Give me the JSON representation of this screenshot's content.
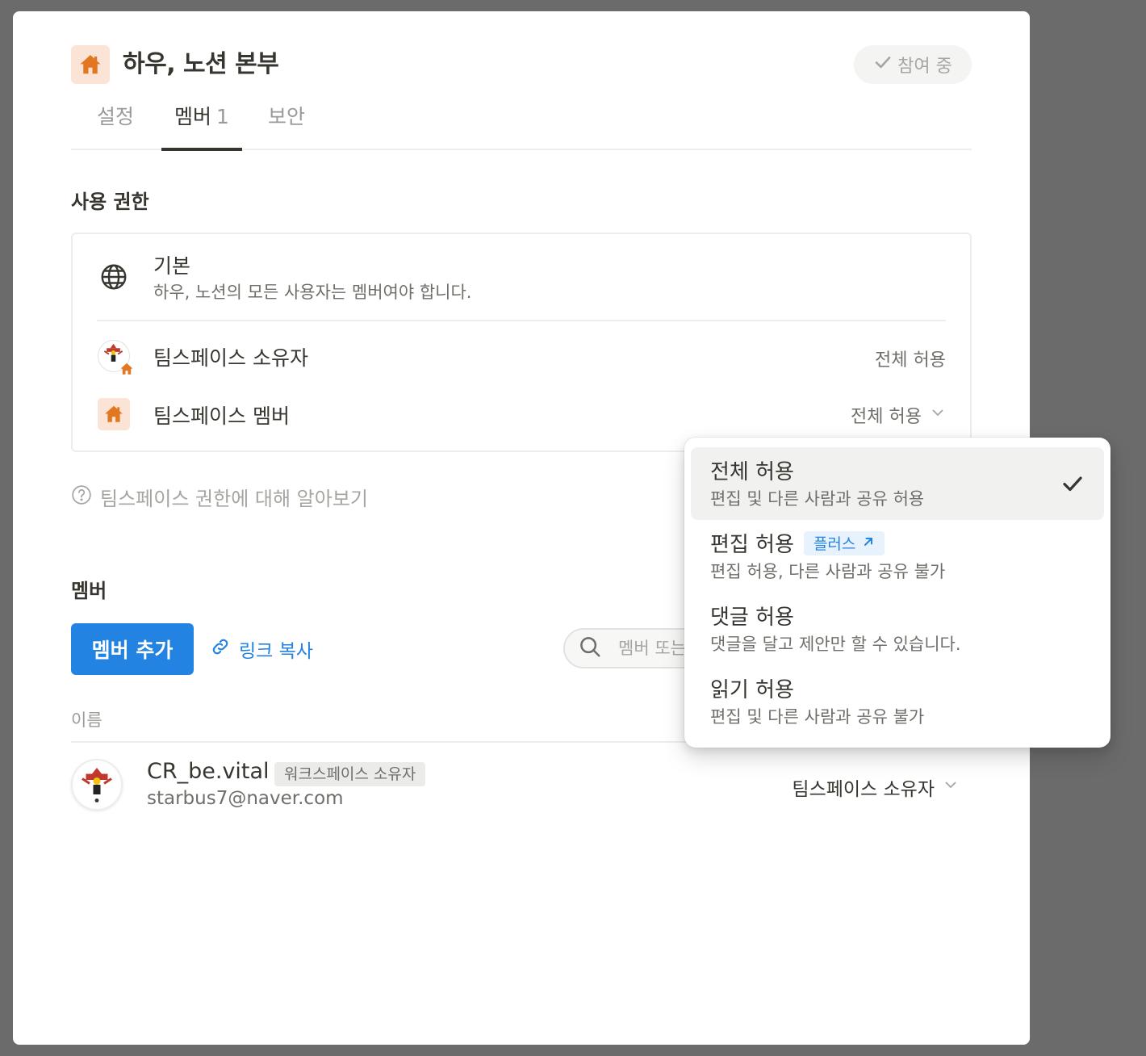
{
  "header": {
    "title": "하우, 노션 본부",
    "icon": "house-icon",
    "joined_label": "참여 중"
  },
  "tabs": [
    {
      "label": "설정"
    },
    {
      "label": "멤버",
      "count": "1"
    },
    {
      "label": "보안"
    }
  ],
  "permissions": {
    "heading": "사용 권한",
    "default": {
      "title": "기본",
      "description": "하우, 노션의 모든 사용자는 멤버여야 합니다."
    },
    "owner": {
      "title": "팀스페이스 소유자",
      "value": "전체 허용"
    },
    "member": {
      "title": "팀스페이스 멤버",
      "value": "전체 허용"
    },
    "learn_more": "팀스페이스 권한에 대해 알아보기"
  },
  "members": {
    "heading": "멤버",
    "add_button": "멤버 추가",
    "copy_link": "링크 복사",
    "search_placeholder": "멤버 또는 그룹 검색",
    "column_name": "이름",
    "list": [
      {
        "name": "CR_be.vital",
        "badge": "워크스페이스 소유자",
        "email": "starbus7@naver.com",
        "role": "팀스페이스 소유자"
      }
    ]
  },
  "dropdown": {
    "items": [
      {
        "title": "전체 허용",
        "description": "편집 및 다른 사람과 공유 허용",
        "selected": true
      },
      {
        "title": "편집 허용",
        "tag": "플러스",
        "description": "편집 허용, 다른 사람과 공유 불가"
      },
      {
        "title": "댓글 허용",
        "description": "댓글을 달고 제안만 할 수 있습니다."
      },
      {
        "title": "읽기 허용",
        "description": "편집 및 다른 사람과 공유 불가"
      }
    ]
  },
  "colors": {
    "accent": "#2383e2",
    "teamspace_icon_bg": "#fbe4d6",
    "teamspace_icon_fg": "#e27722"
  }
}
